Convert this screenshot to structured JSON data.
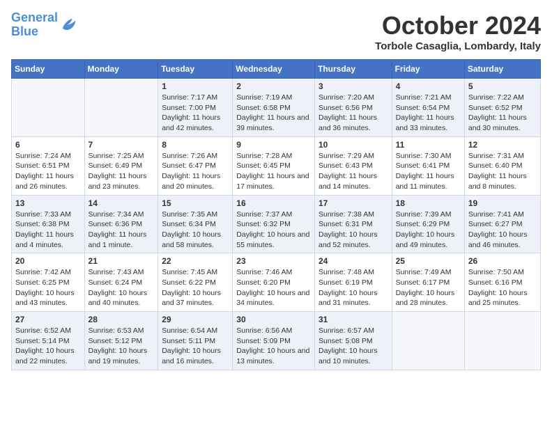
{
  "logo": {
    "line1": "General",
    "line2": "Blue"
  },
  "title": "October 2024",
  "location": "Torbole Casaglia, Lombardy, Italy",
  "days_of_week": [
    "Sunday",
    "Monday",
    "Tuesday",
    "Wednesday",
    "Thursday",
    "Friday",
    "Saturday"
  ],
  "weeks": [
    [
      {
        "day": "",
        "content": ""
      },
      {
        "day": "",
        "content": ""
      },
      {
        "day": "1",
        "content": "Sunrise: 7:17 AM\nSunset: 7:00 PM\nDaylight: 11 hours and 42 minutes."
      },
      {
        "day": "2",
        "content": "Sunrise: 7:19 AM\nSunset: 6:58 PM\nDaylight: 11 hours and 39 minutes."
      },
      {
        "day": "3",
        "content": "Sunrise: 7:20 AM\nSunset: 6:56 PM\nDaylight: 11 hours and 36 minutes."
      },
      {
        "day": "4",
        "content": "Sunrise: 7:21 AM\nSunset: 6:54 PM\nDaylight: 11 hours and 33 minutes."
      },
      {
        "day": "5",
        "content": "Sunrise: 7:22 AM\nSunset: 6:52 PM\nDaylight: 11 hours and 30 minutes."
      }
    ],
    [
      {
        "day": "6",
        "content": "Sunrise: 7:24 AM\nSunset: 6:51 PM\nDaylight: 11 hours and 26 minutes."
      },
      {
        "day": "7",
        "content": "Sunrise: 7:25 AM\nSunset: 6:49 PM\nDaylight: 11 hours and 23 minutes."
      },
      {
        "day": "8",
        "content": "Sunrise: 7:26 AM\nSunset: 6:47 PM\nDaylight: 11 hours and 20 minutes."
      },
      {
        "day": "9",
        "content": "Sunrise: 7:28 AM\nSunset: 6:45 PM\nDaylight: 11 hours and 17 minutes."
      },
      {
        "day": "10",
        "content": "Sunrise: 7:29 AM\nSunset: 6:43 PM\nDaylight: 11 hours and 14 minutes."
      },
      {
        "day": "11",
        "content": "Sunrise: 7:30 AM\nSunset: 6:41 PM\nDaylight: 11 hours and 11 minutes."
      },
      {
        "day": "12",
        "content": "Sunrise: 7:31 AM\nSunset: 6:40 PM\nDaylight: 11 hours and 8 minutes."
      }
    ],
    [
      {
        "day": "13",
        "content": "Sunrise: 7:33 AM\nSunset: 6:38 PM\nDaylight: 11 hours and 4 minutes."
      },
      {
        "day": "14",
        "content": "Sunrise: 7:34 AM\nSunset: 6:36 PM\nDaylight: 11 hours and 1 minute."
      },
      {
        "day": "15",
        "content": "Sunrise: 7:35 AM\nSunset: 6:34 PM\nDaylight: 10 hours and 58 minutes."
      },
      {
        "day": "16",
        "content": "Sunrise: 7:37 AM\nSunset: 6:32 PM\nDaylight: 10 hours and 55 minutes."
      },
      {
        "day": "17",
        "content": "Sunrise: 7:38 AM\nSunset: 6:31 PM\nDaylight: 10 hours and 52 minutes."
      },
      {
        "day": "18",
        "content": "Sunrise: 7:39 AM\nSunset: 6:29 PM\nDaylight: 10 hours and 49 minutes."
      },
      {
        "day": "19",
        "content": "Sunrise: 7:41 AM\nSunset: 6:27 PM\nDaylight: 10 hours and 46 minutes."
      }
    ],
    [
      {
        "day": "20",
        "content": "Sunrise: 7:42 AM\nSunset: 6:25 PM\nDaylight: 10 hours and 43 minutes."
      },
      {
        "day": "21",
        "content": "Sunrise: 7:43 AM\nSunset: 6:24 PM\nDaylight: 10 hours and 40 minutes."
      },
      {
        "day": "22",
        "content": "Sunrise: 7:45 AM\nSunset: 6:22 PM\nDaylight: 10 hours and 37 minutes."
      },
      {
        "day": "23",
        "content": "Sunrise: 7:46 AM\nSunset: 6:20 PM\nDaylight: 10 hours and 34 minutes."
      },
      {
        "day": "24",
        "content": "Sunrise: 7:48 AM\nSunset: 6:19 PM\nDaylight: 10 hours and 31 minutes."
      },
      {
        "day": "25",
        "content": "Sunrise: 7:49 AM\nSunset: 6:17 PM\nDaylight: 10 hours and 28 minutes."
      },
      {
        "day": "26",
        "content": "Sunrise: 7:50 AM\nSunset: 6:16 PM\nDaylight: 10 hours and 25 minutes."
      }
    ],
    [
      {
        "day": "27",
        "content": "Sunrise: 6:52 AM\nSunset: 5:14 PM\nDaylight: 10 hours and 22 minutes."
      },
      {
        "day": "28",
        "content": "Sunrise: 6:53 AM\nSunset: 5:12 PM\nDaylight: 10 hours and 19 minutes."
      },
      {
        "day": "29",
        "content": "Sunrise: 6:54 AM\nSunset: 5:11 PM\nDaylight: 10 hours and 16 minutes."
      },
      {
        "day": "30",
        "content": "Sunrise: 6:56 AM\nSunset: 5:09 PM\nDaylight: 10 hours and 13 minutes."
      },
      {
        "day": "31",
        "content": "Sunrise: 6:57 AM\nSunset: 5:08 PM\nDaylight: 10 hours and 10 minutes."
      },
      {
        "day": "",
        "content": ""
      },
      {
        "day": "",
        "content": ""
      }
    ]
  ]
}
